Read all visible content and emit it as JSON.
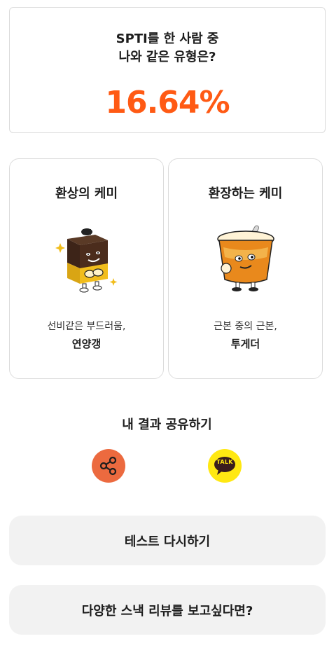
{
  "stat": {
    "question_line1": "SPTI를 한 사람 중",
    "question_line2": "나와 같은 유형은?",
    "percent": "16.64%",
    "accent": "#ff5a14"
  },
  "chemistry": [
    {
      "title": "환상의 케미",
      "desc": "선비같은 부드러움,",
      "name": "연양갱",
      "icon": "yanggaeng-character"
    },
    {
      "title": "환장하는 케미",
      "desc": "근본 중의 근본,",
      "name": "투게더",
      "icon": "ice-cream-cup-character"
    }
  ],
  "share": {
    "title": "내 결과 공유하기",
    "link_icon": "share-icon",
    "link_color": "#ec6a3f",
    "kakao_label": "TALK",
    "kakao_color": "#ffe812"
  },
  "buttons": {
    "retry": "테스트 다시하기",
    "review": "다양한 스낵 리뷰를 보고싶다면?"
  }
}
